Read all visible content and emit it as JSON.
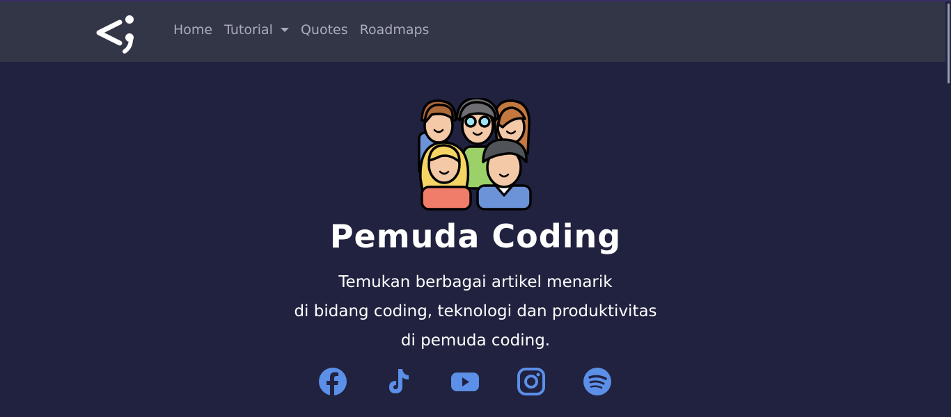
{
  "navbar": {
    "logo_icon": "semicolon-logo-icon",
    "items": [
      {
        "label": "Home"
      },
      {
        "label": "Tutorial",
        "has_dropdown": true
      },
      {
        "label": "Quotes"
      },
      {
        "label": "Roadmaps"
      }
    ]
  },
  "hero": {
    "illustration": "community-group-icon",
    "title": "Pemuda Coding",
    "subtitle_lines": [
      "Temukan berbagai artikel menarik",
      "di bidang coding, teknologi dan produktivitas",
      "di pemuda coding."
    ]
  },
  "socials": [
    {
      "icon": "facebook-icon"
    },
    {
      "icon": "tiktok-icon"
    },
    {
      "icon": "youtube-icon"
    },
    {
      "icon": "instagram-icon"
    },
    {
      "icon": "spotify-icon"
    }
  ],
  "colors": {
    "background": "#20223f",
    "navbar": "#333646",
    "nav_text": "#a9abbf",
    "social_icon": "#5b8fe8"
  }
}
